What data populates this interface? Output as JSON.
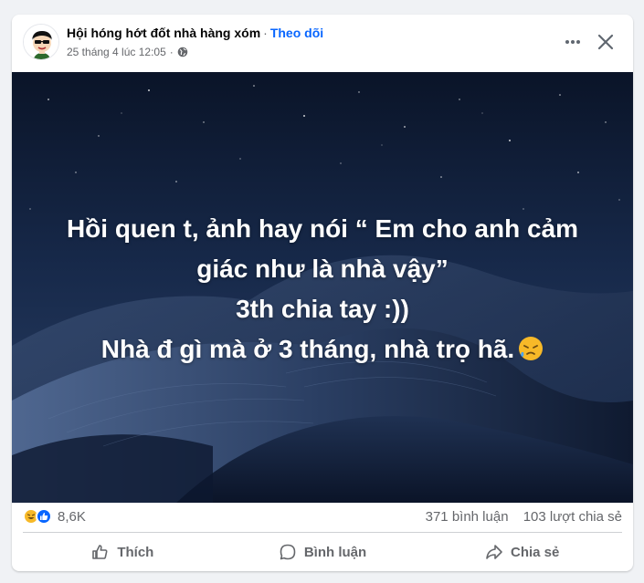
{
  "post": {
    "group_name": "Hội hóng hớt đốt nhà hàng xóm",
    "separator": "·",
    "follow_label": "Theo dõi",
    "timestamp": "25 tháng 4 lúc 12:05",
    "privacy_icon": "globe-icon",
    "more_icon": "more-horizontal-icon",
    "close_icon": "close-icon"
  },
  "image_text": {
    "line1": "Hồi quen t, ảnh hay nói “ Em cho anh cảm",
    "line2": "giác như là nhà vậy”",
    "line3": "3th chia tay :))",
    "line4": "Nhà đ gì mà ở 3 tháng, nhà trọ hã.",
    "emoji": "😪"
  },
  "stats": {
    "reactions": [
      "haha",
      "like"
    ],
    "reaction_count": "8,6K",
    "comments": "371 bình luận",
    "shares": "103 lượt chia sẻ"
  },
  "actions": {
    "like_label": "Thích",
    "comment_label": "Bình luận",
    "share_label": "Chia sẻ"
  },
  "colors": {
    "accent": "#0866ff",
    "muted": "#65676b",
    "like_blue": "#0866ff",
    "haha_yellow": "#f7b928"
  }
}
